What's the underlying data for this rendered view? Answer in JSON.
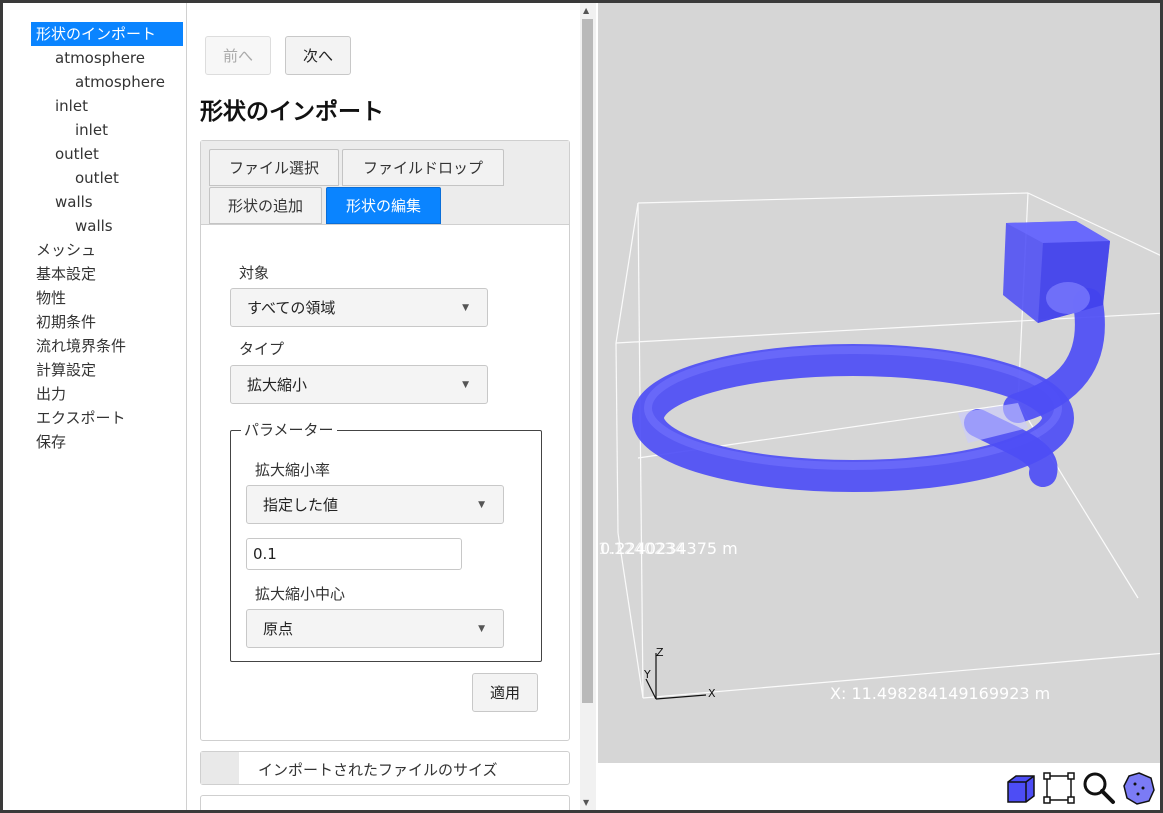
{
  "sidebar": {
    "items": [
      {
        "label": "形状のインポート",
        "level": 0,
        "selected": true
      },
      {
        "label": "atmosphere",
        "level": 1
      },
      {
        "label": "atmosphere",
        "level": 2
      },
      {
        "label": "inlet",
        "level": 1
      },
      {
        "label": "inlet",
        "level": 2
      },
      {
        "label": "outlet",
        "level": 1
      },
      {
        "label": "outlet",
        "level": 2
      },
      {
        "label": "walls",
        "level": 1
      },
      {
        "label": "walls",
        "level": 2
      },
      {
        "label": "メッシュ",
        "level": 0
      },
      {
        "label": "基本設定",
        "level": 0
      },
      {
        "label": "物性",
        "level": 0
      },
      {
        "label": "初期条件",
        "level": 0
      },
      {
        "label": "流れ境界条件",
        "level": 0
      },
      {
        "label": "計算設定",
        "level": 0
      },
      {
        "label": "出力",
        "level": 0
      },
      {
        "label": "エクスポート",
        "level": 0
      },
      {
        "label": "保存",
        "level": 0
      }
    ]
  },
  "nav": {
    "prev_label": "前へ",
    "next_label": "次へ"
  },
  "page_title": "形状のインポート",
  "tabs": {
    "file_select": "ファイル選択",
    "file_drop": "ファイルドロップ",
    "add_shape": "形状の追加",
    "edit_shape": "形状の編集"
  },
  "form": {
    "target_label": "対象",
    "target_value": "すべての領域",
    "type_label": "タイプ",
    "type_value": "拡大縮小",
    "params_legend": "パラメーター",
    "scale_label": "拡大縮小率",
    "scale_mode_value": "指定した値",
    "scale_value": "0.1",
    "center_label": "拡大縮小中心",
    "center_value": "原点",
    "apply_label": "適用"
  },
  "imported_size_label": "インポートされたファイルのサイズ",
  "viewer": {
    "y_measure": "0.2240234375 m",
    "y_measure_overlap": "1.1240234",
    "x_measure": "X: 11.498284149169923 m",
    "axis_x": "X",
    "axis_y": "Y",
    "axis_z": "Z"
  },
  "toolbar": {
    "icons": [
      "cube-view-icon",
      "fit-bounds-icon",
      "zoom-icon",
      "sphere-view-icon"
    ]
  },
  "colors": {
    "accent": "#0a84ff",
    "viewer_bg": "#d6d6d6",
    "mesh": "#4d4df5"
  }
}
